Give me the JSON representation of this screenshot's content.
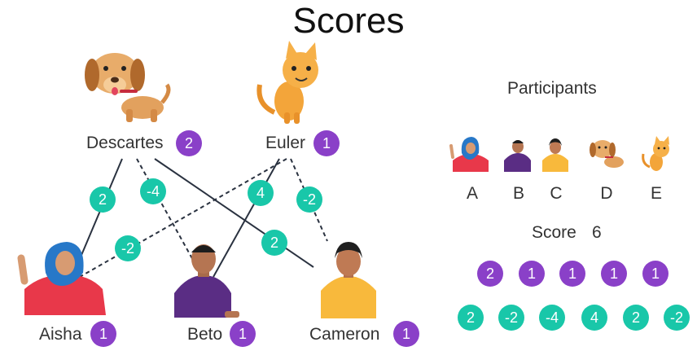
{
  "title": "Scores",
  "colors": {
    "node_badge": "#8a40c8",
    "edge_badge": "#19c7a9",
    "edge_line": "#2a3240"
  },
  "nodes": {
    "descartes": {
      "name": "Descartes",
      "score": "2",
      "icon": "dog-icon"
    },
    "euler": {
      "name": "Euler",
      "score": "1",
      "icon": "cat-icon"
    },
    "aisha": {
      "name": "Aisha",
      "score": "1",
      "icon": "aisha-avatar"
    },
    "beto": {
      "name": "Beto",
      "score": "1",
      "icon": "beto-avatar"
    },
    "cameron": {
      "name": "Cameron",
      "score": "1",
      "icon": "cameron-avatar"
    }
  },
  "edges": [
    {
      "from": "Descartes",
      "to": "Aisha",
      "weight": "2",
      "style": "solid"
    },
    {
      "from": "Descartes",
      "to": "Beto",
      "weight": "-4",
      "style": "dashed"
    },
    {
      "from": "Descartes",
      "to": "Cameron",
      "weight": "2",
      "style": "solid"
    },
    {
      "from": "Euler",
      "to": "Aisha",
      "weight": "-2",
      "style": "dashed"
    },
    {
      "from": "Euler",
      "to": "Beto",
      "weight": "4",
      "style": "solid"
    },
    {
      "from": "Euler",
      "to": "Cameron",
      "weight": "-2",
      "style": "dashed"
    }
  ],
  "panel": {
    "heading": "Participants",
    "participants": [
      {
        "letter": "A",
        "icon": "aisha-avatar"
      },
      {
        "letter": "B",
        "icon": "beto-avatar"
      },
      {
        "letter": "C",
        "icon": "cameron-avatar"
      },
      {
        "letter": "D",
        "icon": "dog-icon"
      },
      {
        "letter": "E",
        "icon": "cat-icon"
      }
    ],
    "score_label": "Score",
    "score_value": "6",
    "node_scores": [
      "2",
      "1",
      "1",
      "1",
      "1"
    ],
    "edge_scores": [
      "2",
      "-2",
      "-4",
      "4",
      "2",
      "-2"
    ]
  }
}
